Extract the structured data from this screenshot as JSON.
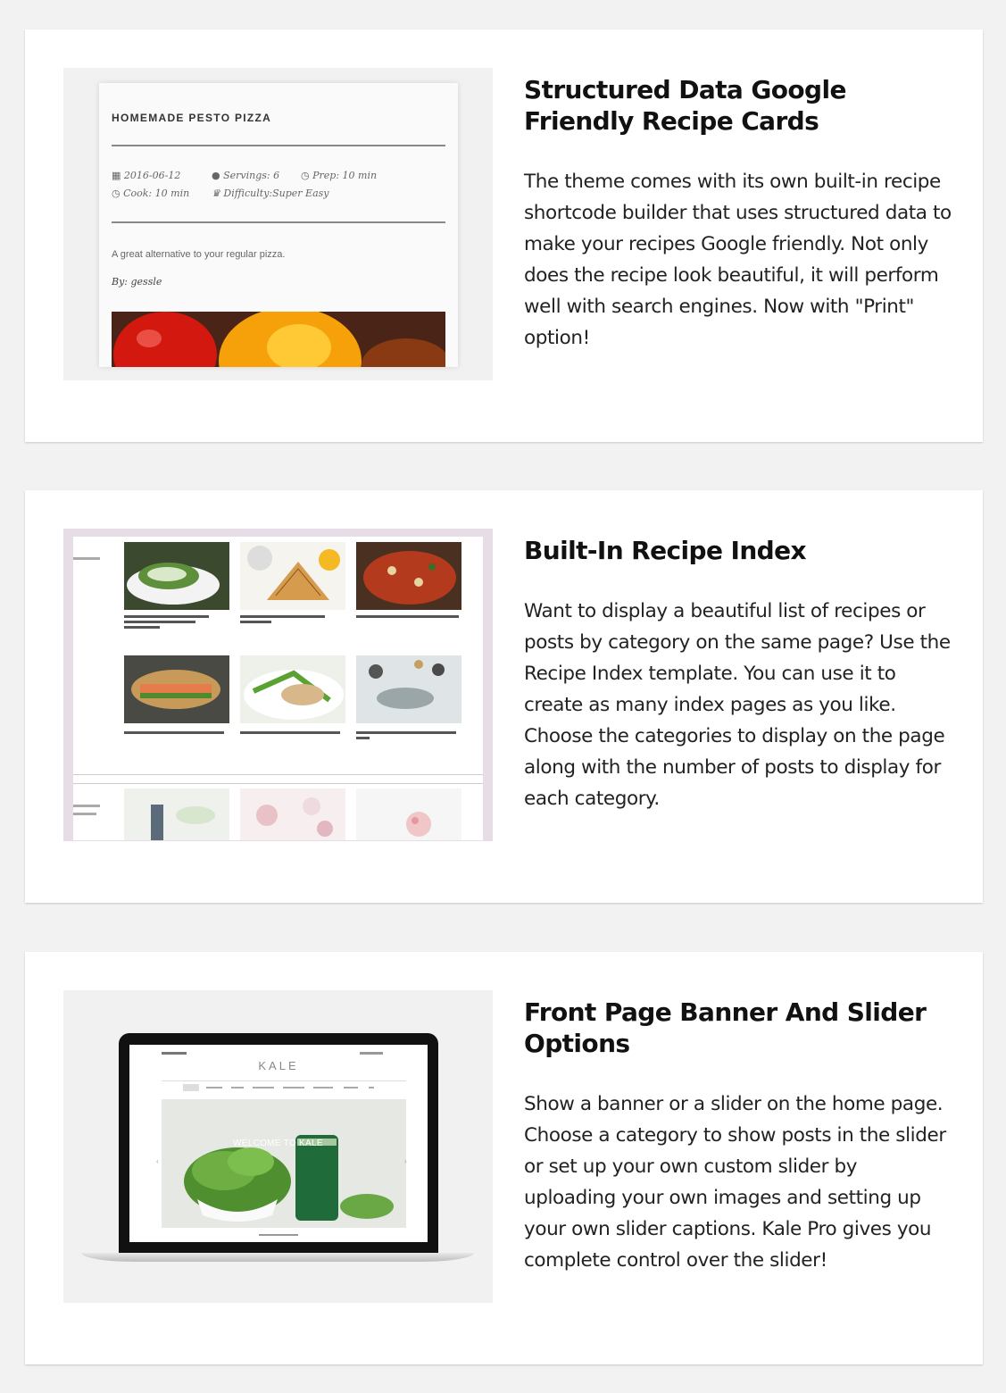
{
  "features": [
    {
      "title": "Structured Data Google Friendly Recipe Cards",
      "description": "The theme comes with its own built-in recipe shortcode builder that uses structured data to make your recipes Google friendly. Not only does the recipe look beautiful, it will perform well with search engines. Now with \"Print\" option!",
      "preview": {
        "recipe_title": "HOMEMADE PESTO PIZZA",
        "date": "2016-06-12",
        "servings": "Servings: 6",
        "prep": "Prep: 10 min",
        "cook": "Cook: 10 min",
        "difficulty": "Difficulty:Super Easy",
        "summary": "A great alternative to your regular pizza.",
        "author": "By: gessle"
      }
    },
    {
      "title": "Built-In Recipe Index",
      "description": "Want to display a beautiful list of recipes or posts by category on the same page? Use the Recipe Index template. You can use it to create as many index pages as you like. Choose the categories to display on the page along with the number of posts to display for each category."
    },
    {
      "title": "Front Page Banner And Slider Options",
      "description": "Show a banner or a slider on the home page. Choose a category to show posts in the slider or set up your own custom slider by uploading your own images and setting up your own slider captions. Kale Pro gives you complete control over the slider!",
      "preview": {
        "site_name": "KALE",
        "hero_caption": "WELCOME TO KALE"
      }
    }
  ],
  "icons": [
    "calendar-icon",
    "person-icon",
    "clock-icon",
    "chef-hat-icon"
  ]
}
